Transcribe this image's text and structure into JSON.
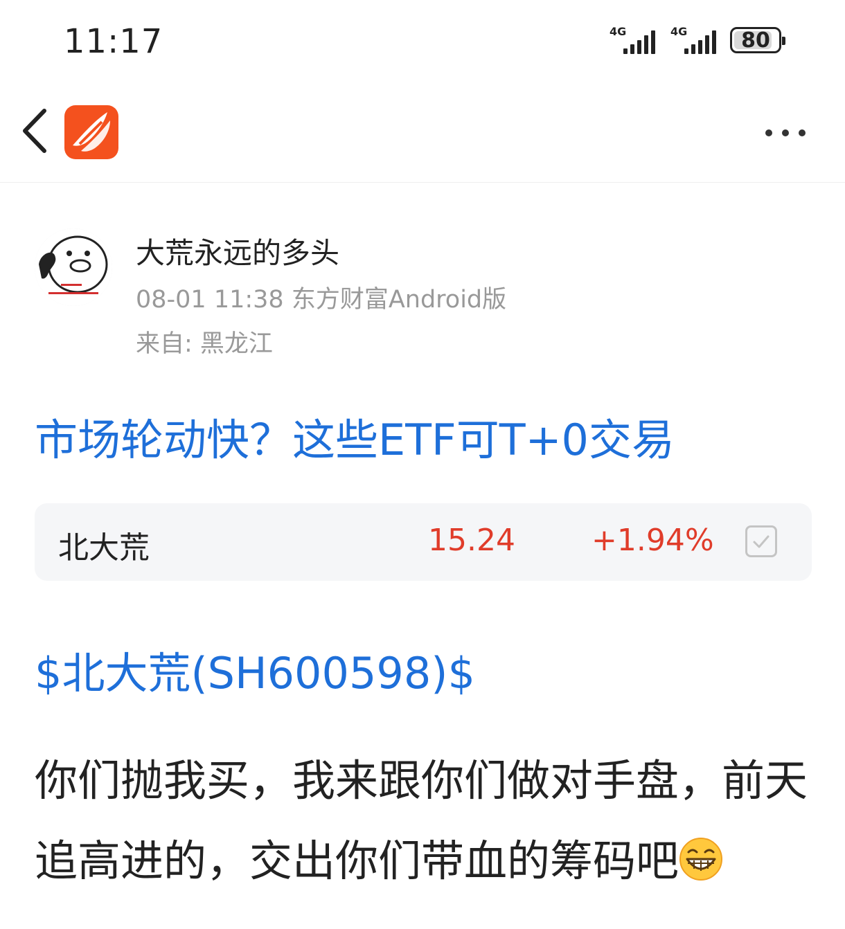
{
  "status": {
    "time": "11:17",
    "signal1_label": "4G",
    "signal2_label": "4G",
    "battery": "80"
  },
  "nav": {
    "back_icon": "chevron-left-icon",
    "logo_icon": "eastmoney-logo-icon",
    "more_icon": "more-horizontal-icon"
  },
  "post": {
    "author": "大荒永远的多头",
    "meta": "08-01 11:38 东方财富Android版",
    "location": "来自: 黑龙江",
    "title": "市场轮动快？这些ETF可T+0交易",
    "stock": {
      "name": "北大荒",
      "price": "15.24",
      "change": "+1.94%"
    },
    "tag": "$北大荒(SH600598)$",
    "body": "你们抛我买，我来跟你们做对手盘，前天追高进的，交出你们带血的筹码吧"
  },
  "colors": {
    "link_blue": "#1e6fd9",
    "up_red": "#e03c2a",
    "brand_orange": "#f4511e"
  }
}
